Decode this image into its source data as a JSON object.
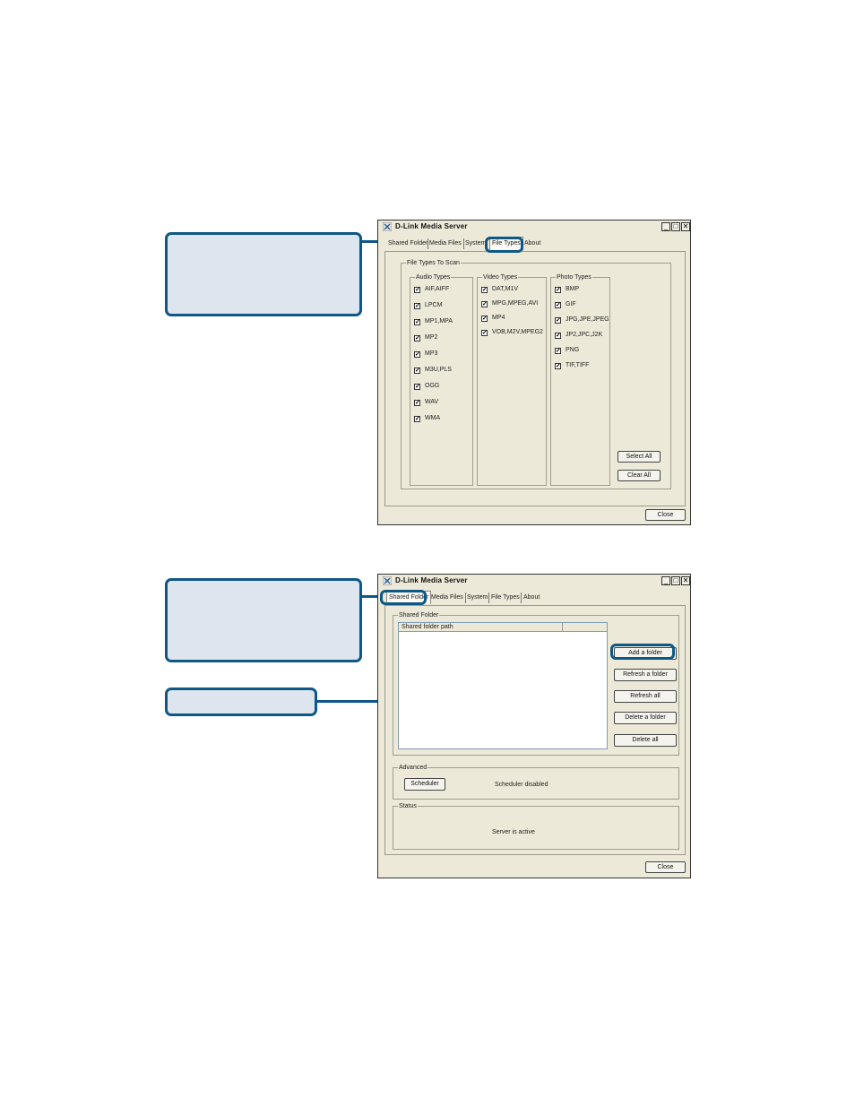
{
  "window1": {
    "title": "D-Link Media Server",
    "tabs": [
      "Shared Folder",
      "Media Files",
      "System",
      "File Types",
      "About"
    ],
    "active_tab": "File Types",
    "group_title": "File Types To Scan",
    "audio": {
      "title": "Audio Types",
      "items": [
        "AIF,AIFF",
        "LPCM",
        "MP1,MPA",
        "MP2",
        "MP3",
        "M3U,PLS",
        "OGG",
        "WAV",
        "WMA"
      ]
    },
    "video": {
      "title": "Video Types",
      "items": [
        "DAT,M1V",
        "MPG,MPEG,AVI",
        "MP4",
        "VOB,M2V,MPEG2"
      ]
    },
    "photo": {
      "title": "Photo Types",
      "items": [
        "BMP",
        "GIF",
        "JPG,JPE,JPEG",
        "JP2,JPC,J2K",
        "PNG",
        "TIF,TIFF"
      ]
    },
    "check_mark": "✓",
    "select_all": "Select All",
    "clear_all": "Clear All",
    "close": "Close"
  },
  "window2": {
    "title": "D-Link Media Server",
    "tabs": [
      "Shared Folder",
      "Media Files",
      "System",
      "File Types",
      "About"
    ],
    "active_tab": "Shared Folder",
    "shared_group": "Shared Folder",
    "column_header": "Shared folder path",
    "add_folder": "Add a folder",
    "refresh_folder": "Refresh a folder",
    "refresh_all": "Refresh all",
    "delete_folder": "Delete a folder",
    "delete_all": "Delete all",
    "advanced_group": "Advanced",
    "scheduler": "Scheduler",
    "scheduler_status": "Scheduler disabled",
    "status_group": "Status",
    "server_status": "Server is active",
    "close": "Close"
  },
  "controls": {
    "minimize": "_",
    "maximize": "□",
    "close": "✕"
  },
  "colors": {
    "callout_fill": "#dde5ee",
    "callout_border": "#0e5886",
    "window_bg": "#ece9d8"
  }
}
